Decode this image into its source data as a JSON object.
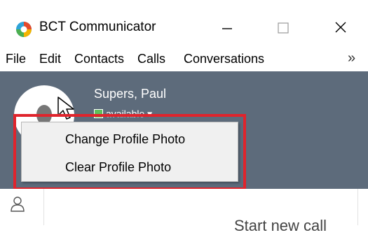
{
  "window": {
    "title": "BCT Communicator",
    "minimize_label": "—",
    "maximize_label": "☐",
    "close_label": "✕"
  },
  "menubar": {
    "items": [
      "File",
      "Edit",
      "Contacts",
      "Calls",
      "Conversations"
    ],
    "more_label": "»"
  },
  "profile": {
    "name": "Supers, Paul",
    "status": "available ▾",
    "status_color": "#5ec15a",
    "header_color": "#5d6b7b"
  },
  "context_menu": {
    "items": [
      "Change Profile Photo",
      "Clear Profile Photo"
    ],
    "highlight_color": "#e0242c"
  },
  "main": {
    "start_new_call": "Start new call"
  },
  "icons": {
    "app": "bct-logo-icon",
    "people": "people-icon",
    "cursor": "cursor-icon"
  }
}
